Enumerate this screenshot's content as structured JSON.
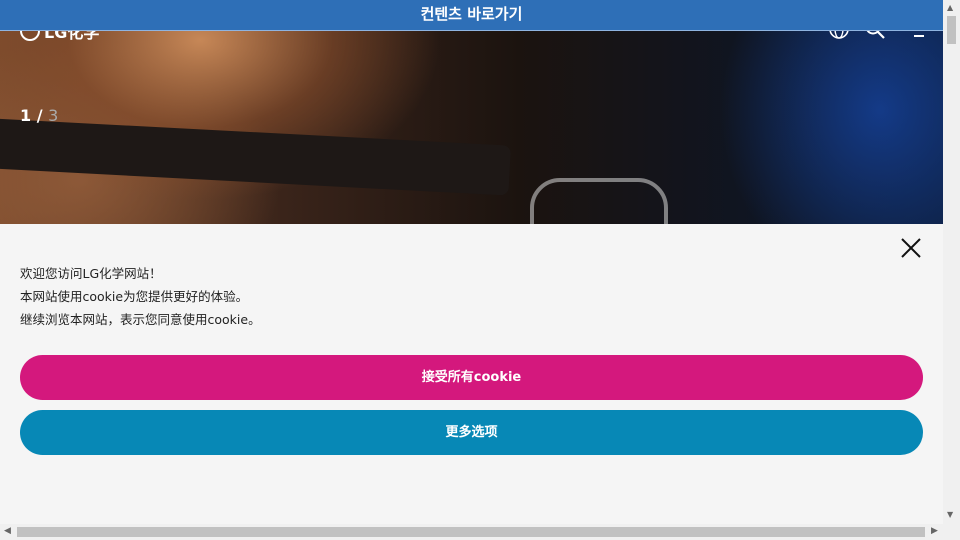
{
  "skip_link": {
    "label": "컨텐츠 바로가기"
  },
  "header": {
    "logo_text": "LG化学",
    "icons": [
      "globe-icon",
      "search-icon",
      "menu-icon"
    ]
  },
  "hero": {
    "slide_current": "1",
    "slide_separator": " / ",
    "slide_total": "3"
  },
  "cookie_banner": {
    "lines": [
      "欢迎您访问LG化学网站！",
      "本网站使用cookie为您提供更好的体验。",
      "继续浏览本网站，表示您同意使用cookie。"
    ],
    "accept_label": "接受所有cookie",
    "more_label": "更多选项",
    "accept_color": "#d4187d",
    "more_color": "#0788b6",
    "close_icon": "close-icon"
  }
}
